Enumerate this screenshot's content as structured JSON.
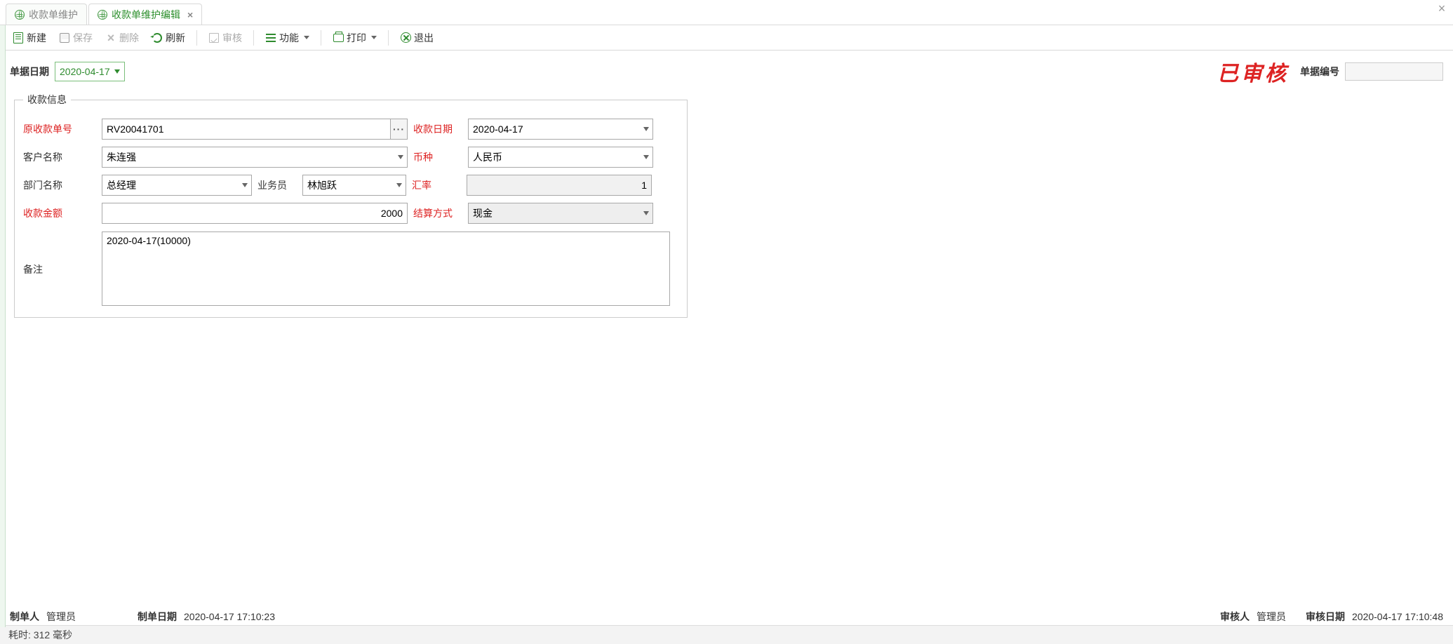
{
  "tabs": {
    "inactive": "收款单维护",
    "active": "收款单维护编辑"
  },
  "toolbar": {
    "new": "新建",
    "save": "保存",
    "delete": "删除",
    "refresh": "刷新",
    "audit": "审核",
    "func": "功能",
    "print": "打印",
    "exit": "退出"
  },
  "header": {
    "doc_date_label": "单据日期",
    "doc_date": "2020-04-17",
    "stamp": "已审核",
    "doc_no_label": "单据编号",
    "doc_no": ""
  },
  "form": {
    "legend": "收款信息",
    "orig_no_label": "原收款单号",
    "orig_no": "RV20041701",
    "rcv_date_label": "收款日期",
    "rcv_date": "2020-04-17",
    "cust_label": "客户名称",
    "cust": "朱连强",
    "currency_label": "币种",
    "currency": "人民币",
    "dept_label": "部门名称",
    "dept": "总经理",
    "sales_label": "业务员",
    "sales": "林旭跃",
    "rate_label": "汇率",
    "rate": "1",
    "amount_label": "收款金额",
    "amount": "2000",
    "settle_label": "结算方式",
    "settle": "现金",
    "memo_label": "备注",
    "memo": "2020-04-17(10000)"
  },
  "footer": {
    "maker_label": "制单人",
    "maker": "管理员",
    "make_date_label": "制单日期",
    "make_date": "2020-04-17 17:10:23",
    "auditor_label": "审核人",
    "auditor": "管理员",
    "audit_date_label": "审核日期",
    "audit_date": "2020-04-17 17:10:48"
  },
  "status": "耗时: 312 毫秒"
}
